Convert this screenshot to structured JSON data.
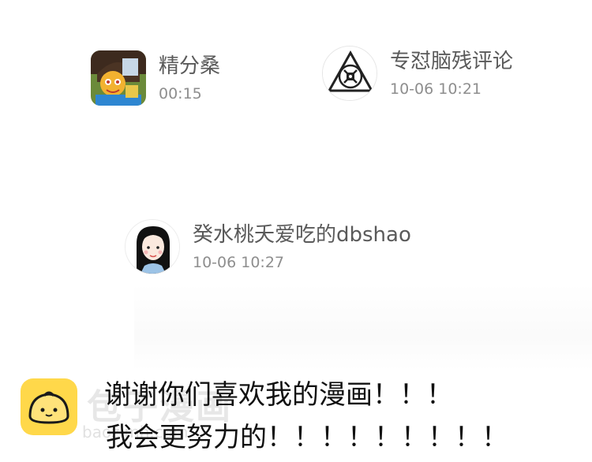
{
  "comments": [
    {
      "username": "精分桑",
      "time": "00:15"
    },
    {
      "username": "专怼脑残评论",
      "time": "10-06 10:21"
    },
    {
      "username": "癸水桃夭爱吃的dbshao",
      "time": "10-06 10:27"
    }
  ],
  "author_note": {
    "line1": "谢谢你们喜欢我的漫画！！！",
    "line2": "我会更努力的！！！！！！！！！"
  },
  "watermark": {
    "title": "包子漫画",
    "url": "baozimh.com"
  },
  "colors": {
    "username": "#5a5a5a",
    "timestamp": "#8e8e8e",
    "logo_yellow": "#ffd84a"
  }
}
